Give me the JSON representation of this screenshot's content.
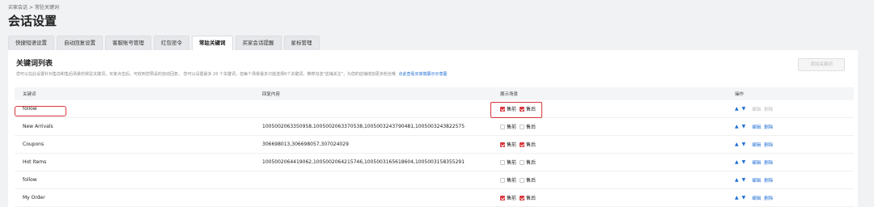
{
  "breadcrumb": {
    "parent": "买家会话",
    "separator": ">",
    "current": "常驻关键词"
  },
  "page_title": "会话设置",
  "tabs": [
    {
      "label": "快捷短语设置",
      "active": false
    },
    {
      "label": "自动回复设置",
      "active": false
    },
    {
      "label": "客服账号管理",
      "active": false
    },
    {
      "label": "红包密令",
      "active": false
    },
    {
      "label": "常驻关键词",
      "active": true
    },
    {
      "label": "买家会话提醒",
      "active": false
    },
    {
      "label": "星标管理",
      "active": false
    }
  ],
  "section": {
    "title": "关键词列表",
    "description": "您可以在此设置针对售前和售后场景的常驻关键词，买家点击后，可收到您预设的自动回复。 您可以设置最多 20 个关键词，但每个场景最多只能选择6个关键词。推荐勾选\"店铺关注\"，为您的店铺增加更多粉丝哦",
    "demo_link": "点此查看买家端展示示意图",
    "add_button": "添加关键词"
  },
  "table": {
    "columns": {
      "keyword": "关键词",
      "reply": "回复内容",
      "scene": "展示场景",
      "ops": "操作"
    },
    "presale_label": "售前",
    "aftersale_label": "售后",
    "edit_label": "编辑",
    "delete_label": "删除",
    "up_arrow": "▲",
    "down_arrow": "▼",
    "rows": [
      {
        "keyword": "follow",
        "reply": "",
        "presale": true,
        "aftersale": true,
        "edit_enabled": false
      },
      {
        "keyword": "New Arrivals",
        "reply": "1005002063350958,1005002063370538,1005003243790481,1005003243822575",
        "presale": false,
        "aftersale": false,
        "edit_enabled": true
      },
      {
        "keyword": "Coupons",
        "reply": "306698013,306698057,307024029",
        "presale": true,
        "aftersale": true,
        "edit_enabled": true
      },
      {
        "keyword": "Hot Items",
        "reply": "1005002064419062,1005002064215746,1005003165618604,1005003158355291",
        "presale": false,
        "aftersale": false,
        "edit_enabled": true
      },
      {
        "keyword": "follow",
        "reply": "",
        "presale": false,
        "aftersale": false,
        "edit_enabled": true
      },
      {
        "keyword": "My Order",
        "reply": "",
        "presale": true,
        "aftersale": true,
        "edit_enabled": true
      }
    ]
  },
  "colors": {
    "accent": "#d9363e",
    "link": "#1f6ed4"
  }
}
